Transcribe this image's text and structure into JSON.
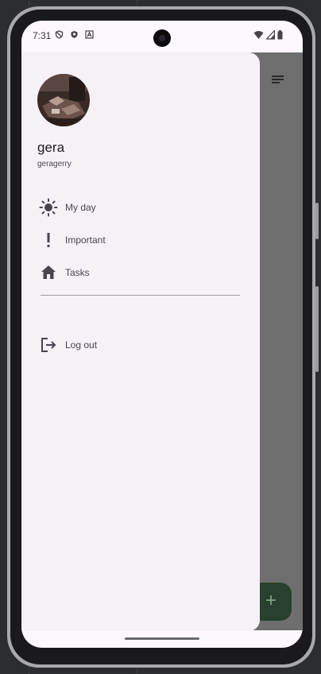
{
  "status_bar": {
    "time": "7:31"
  },
  "drawer": {
    "user": {
      "name": "gera",
      "handle": "geragerry"
    },
    "items": [
      {
        "label": "My day",
        "icon": "sun-icon"
      },
      {
        "label": "Important",
        "icon": "exclamation-icon"
      },
      {
        "label": "Tasks",
        "icon": "home-icon"
      }
    ],
    "logout": {
      "label": "Log out",
      "icon": "logout-icon"
    }
  },
  "fab": {
    "symbol": "+"
  },
  "colors": {
    "drawer_bg": "#f6f1f7",
    "scrim": "#6e6e6e",
    "fab_bg": "#28402e",
    "icon": "#49454f"
  }
}
